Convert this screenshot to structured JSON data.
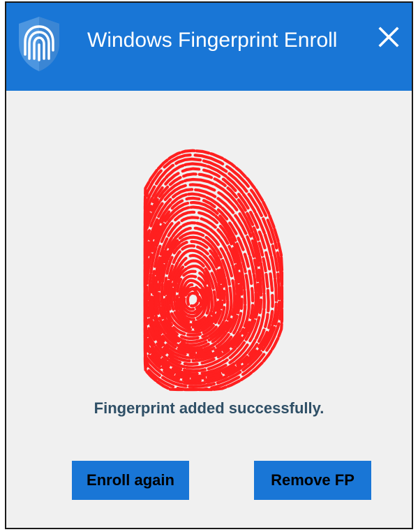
{
  "window": {
    "title": "Windows Fingerprint Enroll",
    "app_icon": "shield-fingerprint-icon",
    "close_icon": "close-icon"
  },
  "main": {
    "graphic_icon": "fingerprint-icon",
    "status_text": "Fingerprint added successfully."
  },
  "actions": {
    "enroll_again_label": "Enroll again",
    "remove_fp_label": "Remove FP"
  },
  "colors": {
    "accent": "#1976d6",
    "window_background": "#f0f0f0",
    "fingerprint": "#ff1a1a",
    "status_text": "#2f4f66"
  }
}
